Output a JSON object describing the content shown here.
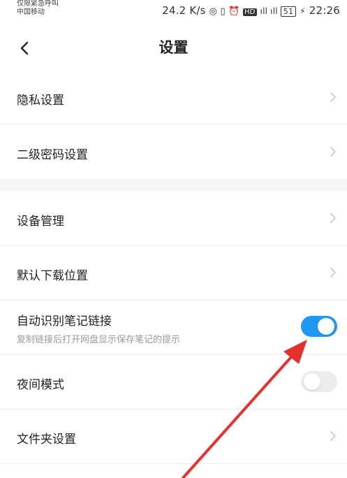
{
  "status_bar": {
    "line1": "仅限紧急呼叫",
    "line2": "中国移动",
    "right_text": "24.2 K/s ◎¹⃝ ⏰ HD ⁴⁶ıl 51 ⚡ 22:26",
    "speed": "24.2 K/s",
    "battery": "51",
    "time": "22:26"
  },
  "header": {
    "title": "设置"
  },
  "settings": {
    "items": [
      {
        "label": "隐私设置"
      },
      {
        "label": "二级密码设置"
      },
      {
        "label": "设备管理"
      },
      {
        "label": "默认下载位置"
      },
      {
        "label": "自动识别笔记链接",
        "sub": "复制链接后打开网盘显示保存笔记的提示",
        "toggle": true
      },
      {
        "label": "夜间模式",
        "toggle": false
      },
      {
        "label": "文件夹设置"
      }
    ]
  },
  "colors": {
    "toggle_on": "#1e97f5",
    "toggle_off": "#ececec",
    "arrow": "#e5302b"
  }
}
